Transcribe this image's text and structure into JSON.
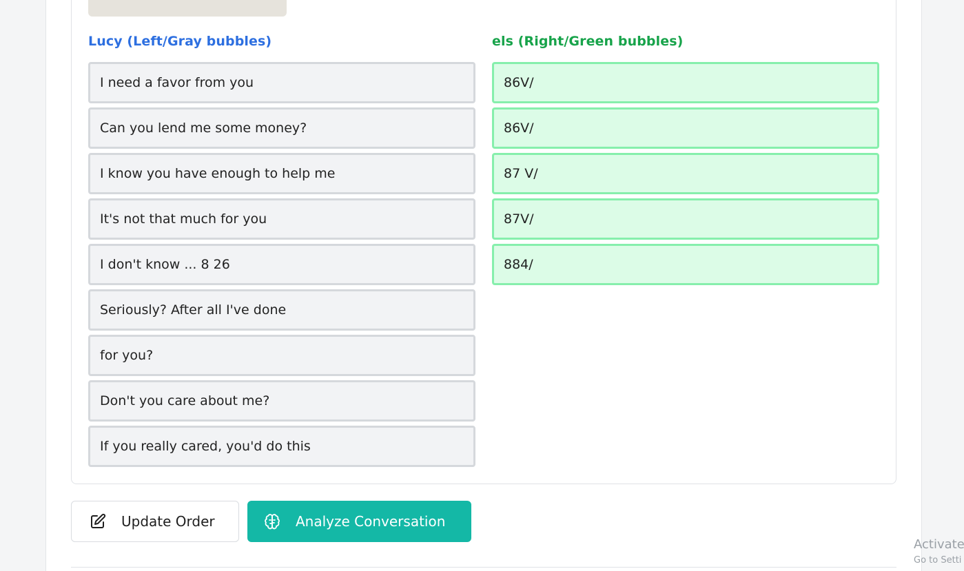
{
  "left_column": {
    "heading": "Lucy (Left/Gray bubbles)",
    "messages": [
      "I need a favor from you",
      "Can you lend me some money?",
      "I know you have enough to help me",
      "It's not that much for you",
      "I don't know ... 8 26",
      "Seriously? After all I've done",
      "for you?",
      "Don't you care about me?",
      "If you really cared, you'd do this"
    ]
  },
  "right_column": {
    "heading": "els (Right/Green bubbles)",
    "messages": [
      "86V/",
      "86V/",
      "87 V/",
      "87V/",
      "884/"
    ]
  },
  "actions": {
    "update_label": "Update Order",
    "analyze_label": "Analyze Conversation"
  },
  "os_watermark": {
    "line1": "Activate",
    "line2": "Go to Setti"
  },
  "colors": {
    "left_heading": "#2d6fe0",
    "right_heading": "#17a34a",
    "gray_bubble_bg": "#f2f3f5",
    "green_bubble_bg": "#dcfce7",
    "green_bubble_border": "#86efac",
    "analyze_button_bg": "#14b8a6"
  }
}
